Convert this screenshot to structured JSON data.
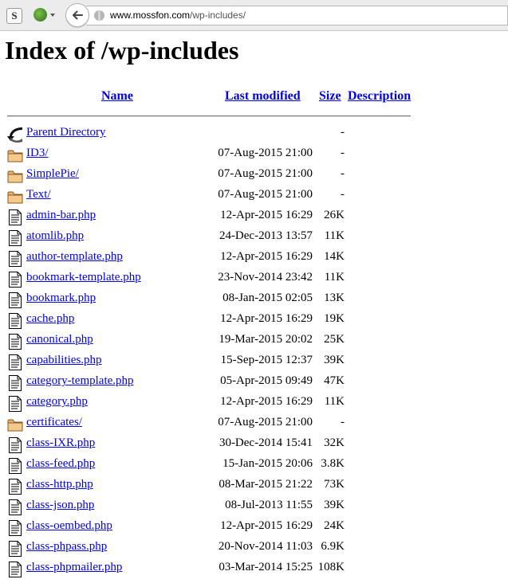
{
  "browser": {
    "url_host": "www.mossfon.com",
    "url_path": "/wp-includes/",
    "extension_letter": "S"
  },
  "page": {
    "title": "Index of /wp-includes",
    "columns": {
      "name": "Name",
      "modified": "Last modified",
      "size": "Size",
      "description": "Description"
    }
  },
  "rows": [
    {
      "name": "Parent Directory",
      "date": "",
      "size": "-",
      "icon": "back-icon"
    },
    {
      "name": "ID3/",
      "date": "07-Aug-2015 21:00",
      "size": "-",
      "icon": "folder-icon"
    },
    {
      "name": "SimplePie/",
      "date": "07-Aug-2015 21:00",
      "size": "-",
      "icon": "folder-icon"
    },
    {
      "name": "Text/",
      "date": "07-Aug-2015 21:00",
      "size": "-",
      "icon": "folder-icon"
    },
    {
      "name": "admin-bar.php",
      "date": "12-Apr-2015 16:29",
      "size": "26K",
      "icon": "file-icon"
    },
    {
      "name": "atomlib.php",
      "date": "24-Dec-2013 13:57",
      "size": "11K",
      "icon": "file-icon"
    },
    {
      "name": "author-template.php",
      "date": "12-Apr-2015 16:29",
      "size": "14K",
      "icon": "file-icon"
    },
    {
      "name": "bookmark-template.php",
      "date": "23-Nov-2014 23:42",
      "size": "11K",
      "icon": "file-icon"
    },
    {
      "name": "bookmark.php",
      "date": "08-Jan-2015 02:05",
      "size": "13K",
      "icon": "file-icon"
    },
    {
      "name": "cache.php",
      "date": "12-Apr-2015 16:29",
      "size": "19K",
      "icon": "file-icon"
    },
    {
      "name": "canonical.php",
      "date": "19-Mar-2015 20:02",
      "size": "25K",
      "icon": "file-icon"
    },
    {
      "name": "capabilities.php",
      "date": "15-Sep-2015 12:37",
      "size": "39K",
      "icon": "file-icon"
    },
    {
      "name": "category-template.php",
      "date": "05-Apr-2015 09:49",
      "size": "47K",
      "icon": "file-icon"
    },
    {
      "name": "category.php",
      "date": "12-Apr-2015 16:29",
      "size": "11K",
      "icon": "file-icon"
    },
    {
      "name": "certificates/",
      "date": "07-Aug-2015 21:00",
      "size": "-",
      "icon": "folder-icon"
    },
    {
      "name": "class-IXR.php",
      "date": "30-Dec-2014 15:41",
      "size": "32K",
      "icon": "file-icon"
    },
    {
      "name": "class-feed.php",
      "date": "15-Jan-2015 20:06",
      "size": "3.8K",
      "icon": "file-icon"
    },
    {
      "name": "class-http.php",
      "date": "08-Mar-2015 21:22",
      "size": "73K",
      "icon": "file-icon"
    },
    {
      "name": "class-json.php",
      "date": "08-Jul-2013 11:55",
      "size": "39K",
      "icon": "file-icon"
    },
    {
      "name": "class-oembed.php",
      "date": "12-Apr-2015 16:29",
      "size": "24K",
      "icon": "file-icon"
    },
    {
      "name": "class-phpass.php",
      "date": "20-Nov-2014 11:03",
      "size": "6.9K",
      "icon": "file-icon"
    },
    {
      "name": "class-phpmailer.php",
      "date": "03-Mar-2014 15:25",
      "size": "108K",
      "icon": "file-icon"
    }
  ]
}
